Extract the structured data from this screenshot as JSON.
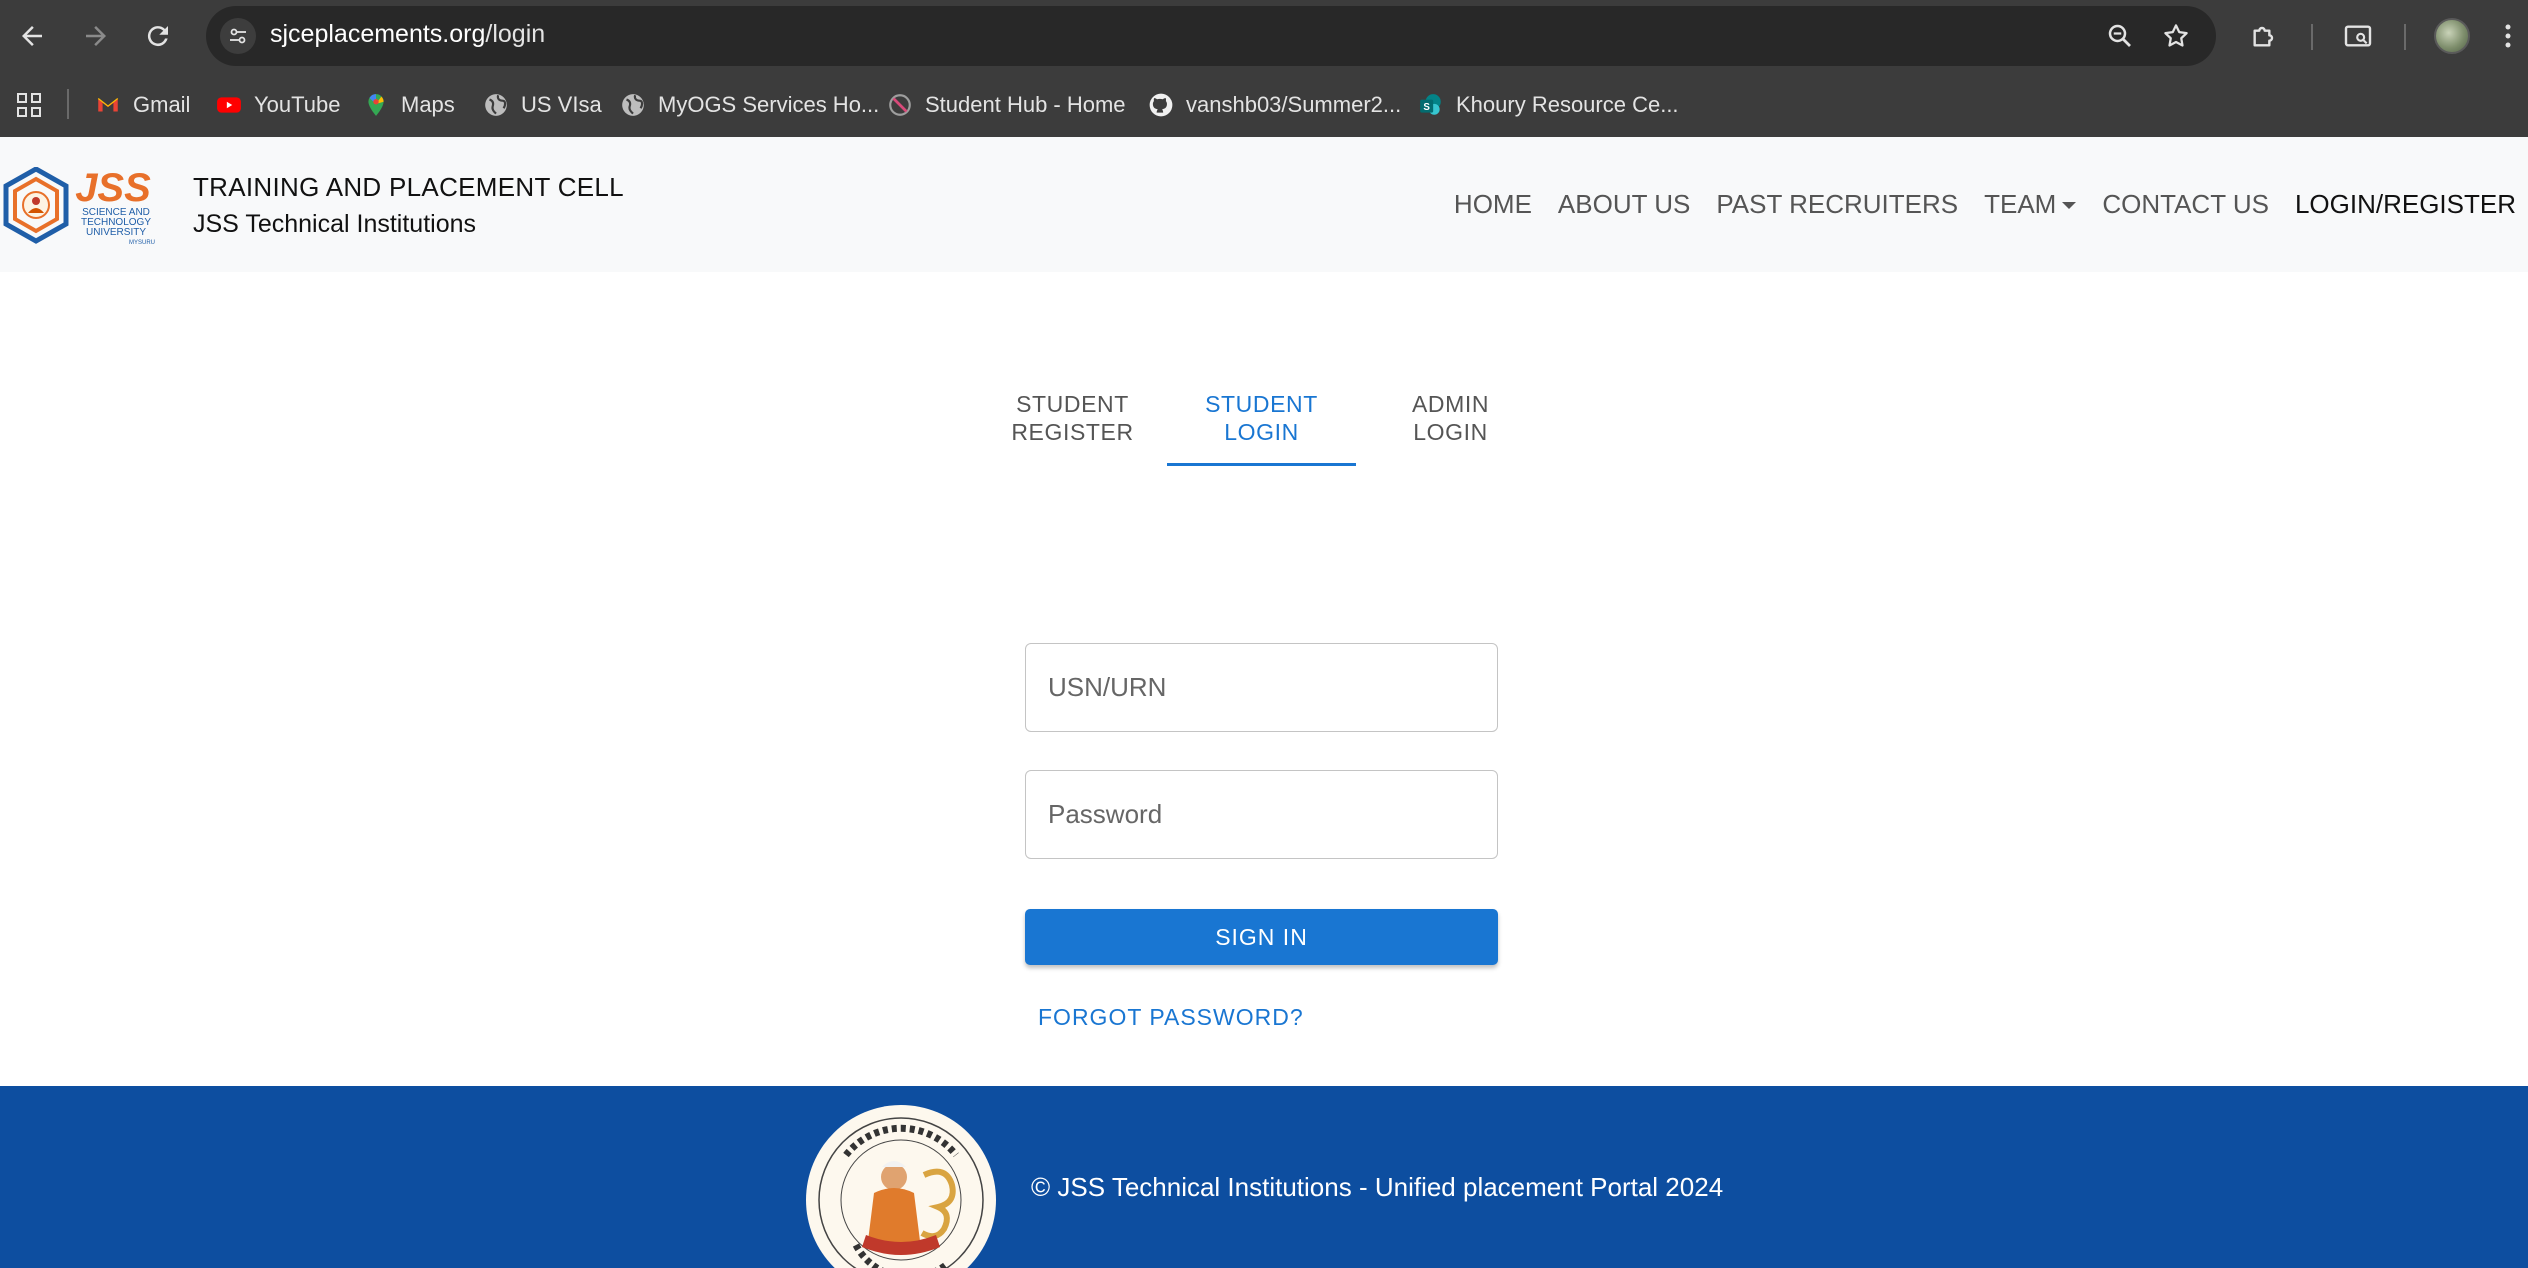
{
  "browser": {
    "url_host": "sjceplacements.org",
    "url_path": "/login",
    "bookmarks": [
      {
        "label": "Gmail",
        "icon": "gmail-icon"
      },
      {
        "label": "YouTube",
        "icon": "youtube-icon"
      },
      {
        "label": "Maps",
        "icon": "maps-icon"
      },
      {
        "label": "US VIsa",
        "icon": "globe-icon"
      },
      {
        "label": "MyOGS Services Ho...",
        "icon": "globe-icon"
      },
      {
        "label": "Student Hub - Home",
        "icon": "student-hub-icon"
      },
      {
        "label": "vanshb03/Summer2...",
        "icon": "github-icon"
      },
      {
        "label": "Khoury Resource Ce...",
        "icon": "sharepoint-icon"
      }
    ]
  },
  "site": {
    "logo_text": "JSS",
    "logo_subtext": "SCIENCE AND TECHNOLOGY UNIVERSITY",
    "title": "TRAINING AND PLACEMENT CELL",
    "subtitle": "JSS Technical Institutions",
    "nav": [
      "HOME",
      "ABOUT US",
      "PAST RECRUITERS",
      "TEAM",
      "CONTACT US",
      "LOGIN/REGISTER"
    ]
  },
  "tabs": {
    "student_register": {
      "line1": "STUDENT",
      "line2": "REGISTER"
    },
    "student_login": {
      "line1": "STUDENT",
      "line2": "LOGIN"
    },
    "admin_login": {
      "line1": "ADMIN",
      "line2": "LOGIN"
    }
  },
  "form": {
    "usn_placeholder": "USN/URN",
    "password_placeholder": "Password",
    "signin_label": "SIGN IN",
    "forgot_label": "FORGOT PASSWORD?"
  },
  "footer": {
    "text": "© JSS Technical Institutions - Unified placement Portal 2024"
  },
  "colors": {
    "primary": "#1976d2",
    "footer_bg": "#0d4ea0",
    "chrome_bg": "#3c3c3c",
    "logo_orange": "#e8702a",
    "logo_blue": "#1f5ea8"
  }
}
